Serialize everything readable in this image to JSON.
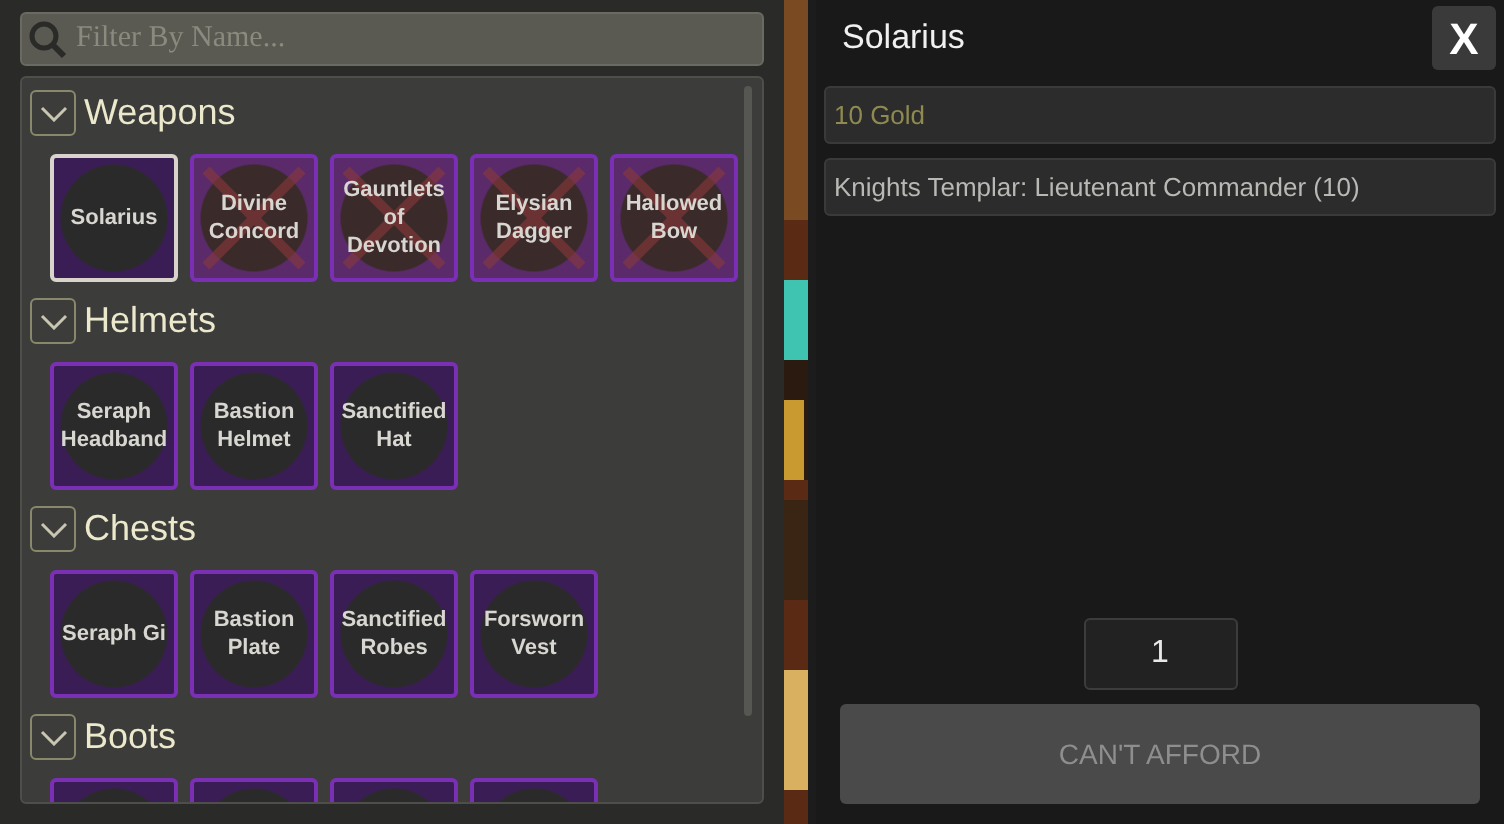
{
  "search": {
    "placeholder": "Filter By Name..."
  },
  "categories": [
    {
      "title": "Weapons",
      "expanded": true,
      "items": [
        {
          "name": "Solarius",
          "selected": true,
          "locked": false
        },
        {
          "name": "Divine Concord",
          "selected": false,
          "locked": true
        },
        {
          "name": "Gauntlets of Devotion",
          "selected": false,
          "locked": true
        },
        {
          "name": "Elysian Dagger",
          "selected": false,
          "locked": true
        },
        {
          "name": "Hallowed Bow",
          "selected": false,
          "locked": true
        }
      ]
    },
    {
      "title": "Helmets",
      "expanded": true,
      "items": [
        {
          "name": "Seraph Headband",
          "selected": false,
          "locked": false
        },
        {
          "name": "Bastion Helmet",
          "selected": false,
          "locked": false
        },
        {
          "name": "Sanctified Hat",
          "selected": false,
          "locked": false
        }
      ]
    },
    {
      "title": "Chests",
      "expanded": true,
      "items": [
        {
          "name": "Seraph Gi",
          "selected": false,
          "locked": false
        },
        {
          "name": "Bastion Plate",
          "selected": false,
          "locked": false
        },
        {
          "name": "Sanctified Robes",
          "selected": false,
          "locked": false
        },
        {
          "name": "Forsworn Vest",
          "selected": false,
          "locked": false
        }
      ]
    },
    {
      "title": "Boots",
      "expanded": true,
      "items": [
        {
          "selected": false,
          "locked": false
        },
        {
          "selected": false,
          "locked": false
        },
        {
          "selected": false,
          "locked": false
        },
        {
          "selected": false,
          "locked": false
        }
      ]
    }
  ],
  "detail": {
    "title": "Solarius",
    "close": "X",
    "cost": "10 Gold",
    "requirement": "Knights Templar: Lieutenant Commander (10)",
    "quantity": "1",
    "action": {
      "label": "CAN'T AFFORD",
      "disabled": true
    }
  }
}
